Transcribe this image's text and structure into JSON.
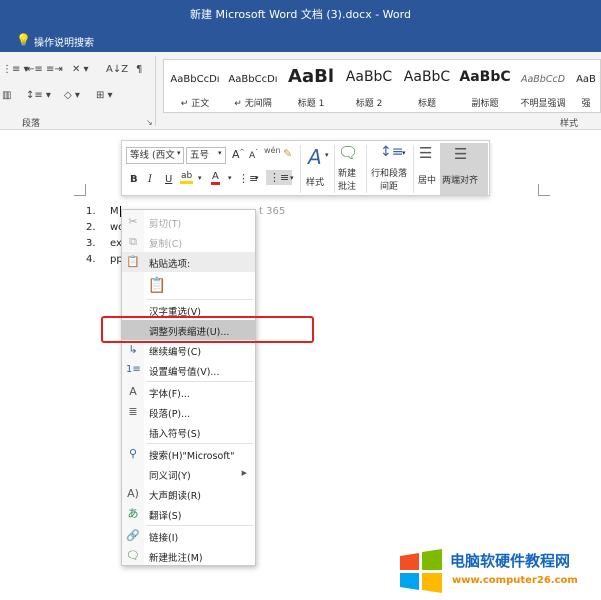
{
  "window": {
    "title": "新建 Microsoft Word 文档 (3).docx  -  Word"
  },
  "tell_me": {
    "label": "操作说明搜索"
  },
  "ribbon": {
    "paragraph_group_label": "段落",
    "styles_group_label": "样式",
    "styles": [
      {
        "sample": "AaBbCcDı",
        "name": "↵ 正文"
      },
      {
        "sample": "AaBbCcDı",
        "name": "↵ 无间隔"
      },
      {
        "sample": "AaBl",
        "name": "标题 1"
      },
      {
        "sample": "AaBbC",
        "name": "标题 2"
      },
      {
        "sample": "AaBbC",
        "name": "标题"
      },
      {
        "sample": "AaBbC",
        "name": "副标题"
      },
      {
        "sample": "AaBbCcD",
        "name": "不明显强调"
      },
      {
        "sample": "AaB",
        "name": "强"
      }
    ]
  },
  "mini_toolbar": {
    "font_name": "等线 (西文",
    "font_size": "五号",
    "grow_font": "A",
    "shrink_font": "A",
    "phonetic": "wén",
    "bold": "B",
    "italic": "I",
    "underline": "U",
    "highlight": "ab",
    "font_color": "A",
    "styles_label": "样式",
    "new_comment_label1": "新建",
    "new_comment_label2": "批注",
    "line_spacing_label1": "行和段落",
    "line_spacing_label2": "间距",
    "center_label": "居中",
    "justify_label": "两端对齐"
  },
  "document": {
    "list_items": [
      {
        "num": "1.",
        "text": "M"
      },
      {
        "num": "2.",
        "text": "wo"
      },
      {
        "num": "3.",
        "text": "ex"
      },
      {
        "num": "4.",
        "text": "pp"
      }
    ],
    "partial_text": "t 365"
  },
  "context_menu": {
    "cut": "剪切(T)",
    "copy": "复制(C)",
    "paste_options": "粘贴选项:",
    "reconvert": "汉字重选(V)",
    "adjust_list_indent": "调整列表缩进(U)...",
    "continue_numbering": "继续编号(C)",
    "set_numbering_value": "设置编号值(V)...",
    "font": "字体(F)...",
    "paragraph": "段落(P)...",
    "insert_symbol": "插入符号(S)",
    "search": "搜索(H)\"Microsoft\"",
    "synonyms": "同义词(Y)",
    "read_aloud": "大声朗读(R)",
    "translate": "翻译(S)",
    "link": "链接(I)",
    "new_comment": "新建批注(M)"
  },
  "watermark": {
    "title": "电脑软硬件教程网",
    "url": "www.computer26.com",
    "colors": {
      "red": "#f25022",
      "green": "#7fba00",
      "blue": "#00a4ef",
      "yellow": "#ffb900"
    }
  },
  "colors": {
    "titlebar": "#2b579a",
    "highlight_box": "#e02020"
  }
}
